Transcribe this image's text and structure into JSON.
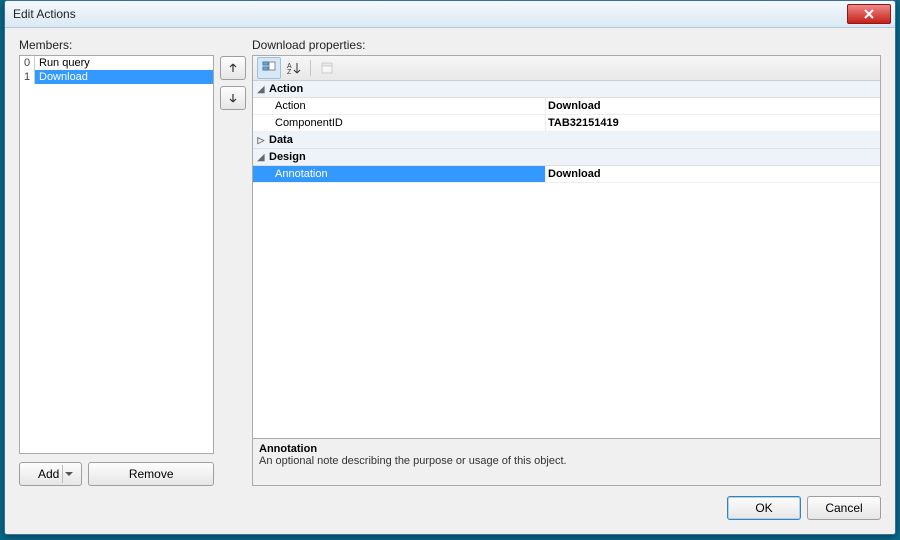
{
  "title": "Edit Actions",
  "members_label": "Members:",
  "members": [
    {
      "index": "0",
      "name": "Run query",
      "selected": false
    },
    {
      "index": "1",
      "name": "Download",
      "selected": true
    }
  ],
  "add_label": "Add",
  "remove_label": "Remove",
  "properties_label": "Download properties:",
  "propgrid": {
    "categories": [
      {
        "name": "Action",
        "expanded": true,
        "rows": [
          {
            "name": "Action",
            "value": "Download",
            "selected": false
          },
          {
            "name": "ComponentID",
            "value": "TAB32151419",
            "selected": false
          }
        ]
      },
      {
        "name": "Data",
        "expanded": false,
        "rows": []
      },
      {
        "name": "Design",
        "expanded": true,
        "rows": [
          {
            "name": "Annotation",
            "value": "Download",
            "selected": true
          }
        ]
      }
    ],
    "description": {
      "title": "Annotation",
      "text": "An optional note describing the purpose or usage of this object."
    }
  },
  "ok_label": "OK",
  "cancel_label": "Cancel"
}
